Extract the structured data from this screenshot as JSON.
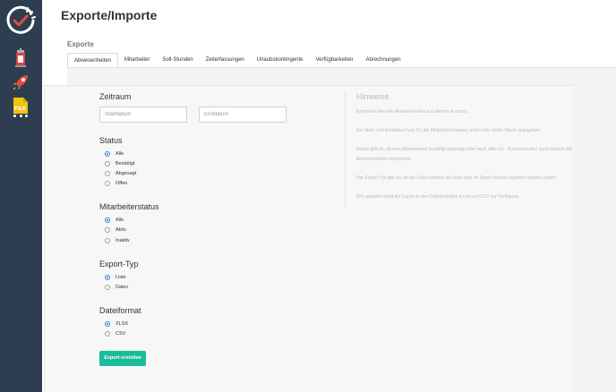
{
  "sidebar": {
    "icons": [
      "clock-check-logo-icon",
      "tower-icon",
      "rocket-icon",
      "file-icon",
      "more-dots-icon"
    ],
    "file_icon_label": "FILE"
  },
  "page": {
    "title": "Exporte/Importe",
    "section": "Exporte"
  },
  "tabs": [
    {
      "label": "Abwesenheiten",
      "active": true
    },
    {
      "label": "Mitarbeiter"
    },
    {
      "label": "Soll-Stunden"
    },
    {
      "label": "Zeiterfassungen"
    },
    {
      "label": "Urlaubskontingente"
    },
    {
      "label": "Verfügbarkeiten"
    },
    {
      "label": "Abrechnungen"
    }
  ],
  "form": {
    "zeitraum": {
      "title": "Zeitraum",
      "start_placeholder": "Startdatum",
      "end_placeholder": "Enddatum"
    },
    "status": {
      "title": "Status",
      "options": [
        "Alle",
        "Bestätigt",
        "Abgesagt",
        "Offen"
      ],
      "selected": "Alle"
    },
    "mitarbeiterstatus": {
      "title": "Mitarbeiterstatus",
      "options": [
        "Alle",
        "Aktiv",
        "Inaktiv"
      ],
      "selected": "Alle"
    },
    "export_typ": {
      "title": "Export-Typ",
      "options": [
        "Liste",
        "Datev"
      ],
      "selected": "Liste"
    },
    "dateiformat": {
      "title": "Dateiformat",
      "options": [
        "XLSX",
        "CSV"
      ],
      "selected": "XLSX"
    },
    "submit_label": "Export erstellen"
  },
  "hints": {
    "title": "Hinweise",
    "items": [
      "Exportiere hier alle Abwesenheiten aus diesem Account.",
      "Bei Start- und Enddatum hast Du die Möglichkeit keinen, einen oder beide Werte anzugeben.",
      "Status gibt an, ob eine Abwesenheit bestätigt abgesagt oder noch offen ist - Du kannst aber auch einfach alle Abwesenheiten exportieren.",
      "Der Export Typ gibt an, ob die Daten einfach als Liste oder im Datev Format exportiert werden sollen.",
      "Wie gewohnt steht der Export in den Dateiformaten Excel und CSV zur Verfügung."
    ]
  },
  "colors": {
    "sidebar": "#2c3e50",
    "accent": "#1abc9c",
    "radio_selected": "#2f7de1",
    "logo_check": "#e74c3c"
  }
}
